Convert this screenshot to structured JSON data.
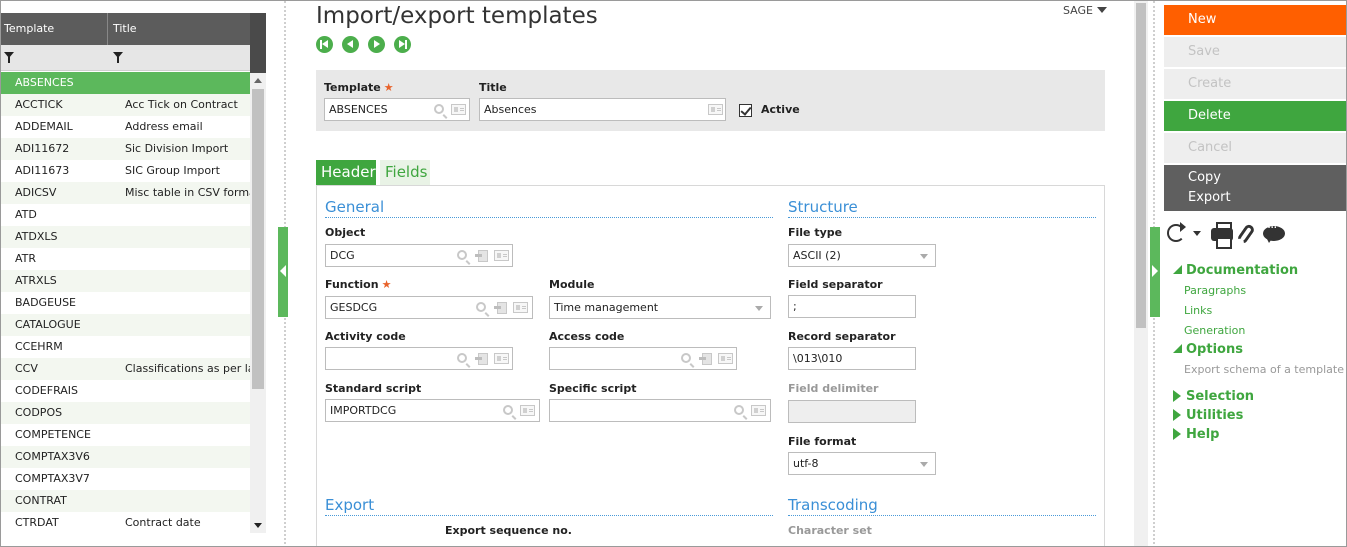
{
  "left_list": {
    "columns": [
      "Template",
      "Title"
    ],
    "rows": [
      {
        "key": "ABSENCES",
        "title": "",
        "selected": true
      },
      {
        "key": "ACCTICK",
        "title": "Acc Tick on Contract"
      },
      {
        "key": "ADDEMAIL",
        "title": "Address email"
      },
      {
        "key": "ADI11672",
        "title": "Sic Division Import"
      },
      {
        "key": "ADI11673",
        "title": "SIC Group Import"
      },
      {
        "key": "ADICSV",
        "title": "Misc table in CSV format"
      },
      {
        "key": "ATD",
        "title": ""
      },
      {
        "key": "ATDXLS",
        "title": ""
      },
      {
        "key": "ATR",
        "title": ""
      },
      {
        "key": "ATRXLS",
        "title": ""
      },
      {
        "key": "BADGEUSE",
        "title": ""
      },
      {
        "key": "CATALOGUE",
        "title": ""
      },
      {
        "key": "CCEHRM",
        "title": ""
      },
      {
        "key": "CCV",
        "title": "Classifications as per labour"
      },
      {
        "key": "CODEFRAIS",
        "title": ""
      },
      {
        "key": "CODPOS",
        "title": ""
      },
      {
        "key": "COMPETENCE",
        "title": ""
      },
      {
        "key": "COMPTAX3V6",
        "title": ""
      },
      {
        "key": "COMPTAX3V7",
        "title": ""
      },
      {
        "key": "CONTRAT",
        "title": ""
      },
      {
        "key": "CTRDAT",
        "title": "Contract date"
      }
    ]
  },
  "page": {
    "title": "Import/export templates",
    "folder": "SAGE"
  },
  "keys": {
    "template_label": "Template",
    "template_value": "ABSENCES",
    "title_label": "Title",
    "title_value": "Absences",
    "active_label": "Active"
  },
  "tabs": [
    "Header",
    "Fields"
  ],
  "general": {
    "section": "General",
    "object_label": "Object",
    "object_value": "DCG",
    "function_label": "Function",
    "function_value": "GESDCG",
    "module_label": "Module",
    "module_value": "Time management",
    "activity_label": "Activity code",
    "activity_value": "",
    "access_label": "Access code",
    "access_value": "",
    "std_script_label": "Standard script",
    "std_script_value": "IMPORTDCG",
    "spec_script_label": "Specific script",
    "spec_script_value": ""
  },
  "structure": {
    "section": "Structure",
    "file_type_label": "File type",
    "file_type_value": "ASCII (2)",
    "field_sep_label": "Field separator",
    "field_sep_value": ";",
    "record_sep_label": "Record separator",
    "record_sep_value": "\\013\\010",
    "field_delim_label": "Field delimiter",
    "field_delim_value": "",
    "file_format_label": "File format",
    "file_format_value": "utf-8"
  },
  "export": {
    "section": "Export",
    "seq_label": "Export sequence no."
  },
  "transcoding": {
    "section": "Transcoding",
    "charset_label": "Character set"
  },
  "actions": {
    "new": "New",
    "save": "Save",
    "create": "Create",
    "delete": "Delete",
    "cancel": "Cancel",
    "copy": "Copy",
    "export": "Export"
  },
  "sidebar": {
    "documentation": "Documentation",
    "paragraphs": "Paragraphs",
    "links": "Links",
    "generation": "Generation",
    "options": "Options",
    "export_schema": "Export schema of a template",
    "selection": "Selection",
    "utilities": "Utilities",
    "help": "Help"
  },
  "colors": {
    "accent_green": "#3fa63f",
    "new_orange": "#ff5f00",
    "section_blue": "#3a8fd6"
  }
}
